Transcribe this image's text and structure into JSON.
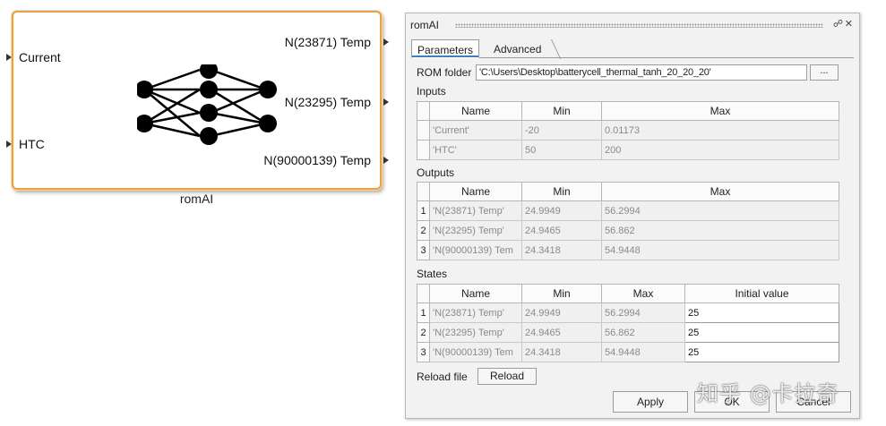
{
  "block": {
    "name": "romAI",
    "inputs": [
      "Current",
      "HTC"
    ],
    "outputs": [
      "N(23871) Temp",
      "N(23295) Temp",
      "N(90000139) Temp"
    ],
    "icon": "neural-network-icon",
    "border_color": "#e6a24a"
  },
  "dialog": {
    "title": "romAI",
    "title_icons": [
      "help-icon",
      "close-icon"
    ],
    "tabs": [
      "Parameters",
      "Advanced"
    ],
    "rom_folder_label": "ROM folder",
    "rom_folder_value": "'C:\\Users\\Desktop\\batterycell_thermal_tanh_20_20_20'",
    "browse_label": "...",
    "inputs": {
      "label": "Inputs",
      "headers": [
        "Name",
        "Min",
        "Max"
      ],
      "rows": [
        {
          "name": "'Current'",
          "min": "-20",
          "max": "0.01173"
        },
        {
          "name": "'HTC'",
          "min": "50",
          "max": "200"
        }
      ]
    },
    "outputs": {
      "label": "Outputs",
      "headers": [
        "Name",
        "Min",
        "Max"
      ],
      "rows": [
        {
          "n": "1",
          "name": "'N(23871) Temp'",
          "min": "24.9949",
          "max": "56.2994"
        },
        {
          "n": "2",
          "name": "'N(23295) Temp'",
          "min": "24.9465",
          "max": "56.862"
        },
        {
          "n": "3",
          "name": "'N(90000139) Tem",
          "min": "24.3418",
          "max": "54.9448"
        }
      ]
    },
    "states": {
      "label": "States",
      "headers": [
        "Name",
        "Min",
        "Max",
        "Initial value"
      ],
      "rows": [
        {
          "n": "1",
          "name": "'N(23871) Temp'",
          "min": "24.9949",
          "max": "56.2994",
          "init": "25"
        },
        {
          "n": "2",
          "name": "'N(23295) Temp'",
          "min": "24.9465",
          "max": "56.862",
          "init": "25"
        },
        {
          "n": "3",
          "name": "'N(90000139) Tem",
          "min": "24.3418",
          "max": "54.9448",
          "init": "25"
        }
      ]
    },
    "reload_label": "Reload file",
    "reload_button": "Reload",
    "buttons": {
      "apply": "Apply",
      "ok": "OK",
      "cancel": "Cancel"
    }
  },
  "watermark": "知乎 @卡拉奇"
}
